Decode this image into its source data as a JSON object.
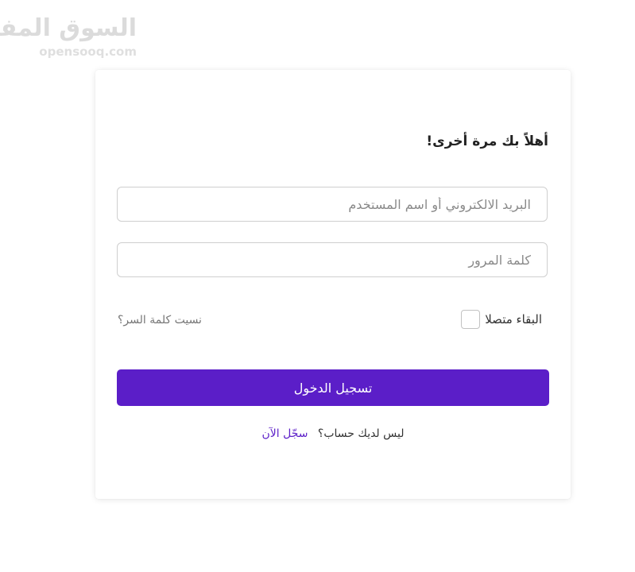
{
  "brand": {
    "logo_arabic": "السوق المفتوح",
    "logo_english": "opensooq.com"
  },
  "login": {
    "welcome": "أهلاً بك مرة أخرى!",
    "email_placeholder": "البريد الالكتروني أو اسم المستخدم",
    "password_placeholder": "كلمة المرور",
    "remember_label": "البقاء متصلا",
    "remember_checked": false,
    "forgot_link": "نسيت كلمة السر؟",
    "submit_label": "تسجيل الدخول",
    "signup_question": "ليس لديك حساب؟",
    "signup_link": "سجّل الآن"
  },
  "colors": {
    "accent": "#5b1ec8",
    "muted_text": "#777777",
    "border": "#cfcfcf"
  }
}
